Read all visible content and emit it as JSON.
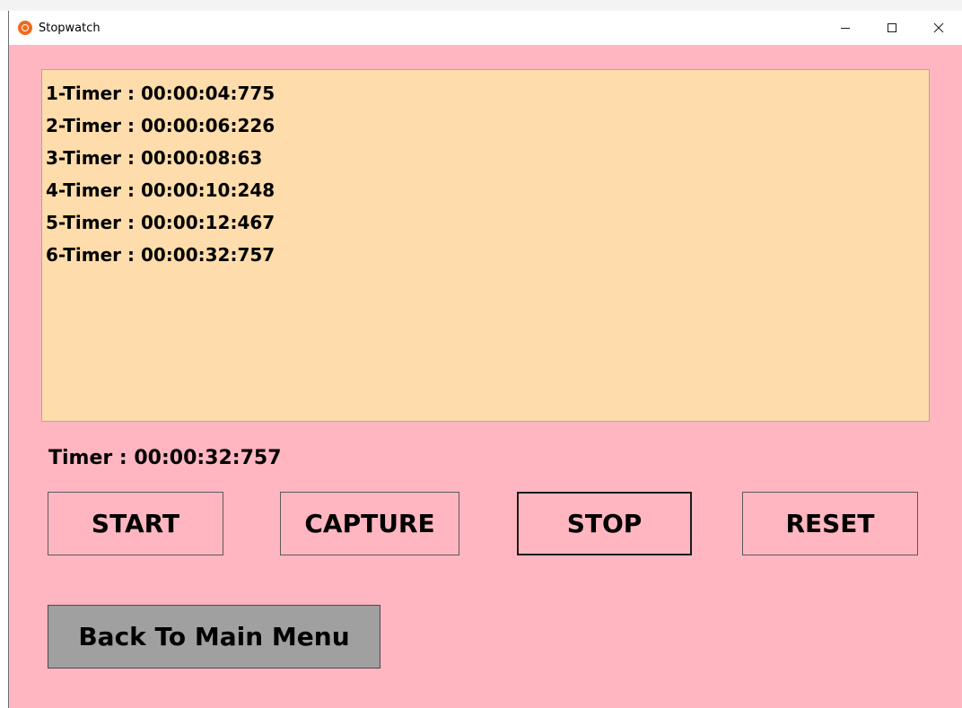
{
  "window": {
    "title": "Stopwatch",
    "icon": "stopwatch-icon",
    "controls": {
      "minimize_icon": "minimize-icon",
      "maximize_icon": "maximize-icon",
      "close_icon": "close-icon"
    }
  },
  "log": {
    "entries": [
      "1-Timer : 00:00:04:775",
      "2-Timer : 00:00:06:226",
      "3-Timer : 00:00:08:63",
      "4-Timer : 00:00:10:248",
      "5-Timer : 00:00:12:467",
      "6-Timer : 00:00:32:757"
    ]
  },
  "timer": {
    "label": "Timer : 00:00:32:757"
  },
  "buttons": {
    "start": "START",
    "capture": "CAPTURE",
    "stop": "STOP",
    "reset": "RESET",
    "back": "Back To Main Menu"
  },
  "colors": {
    "window_bg": "#ffb6c1",
    "log_bg": "#fedcab",
    "back_button_bg": "#a0a0a0"
  }
}
